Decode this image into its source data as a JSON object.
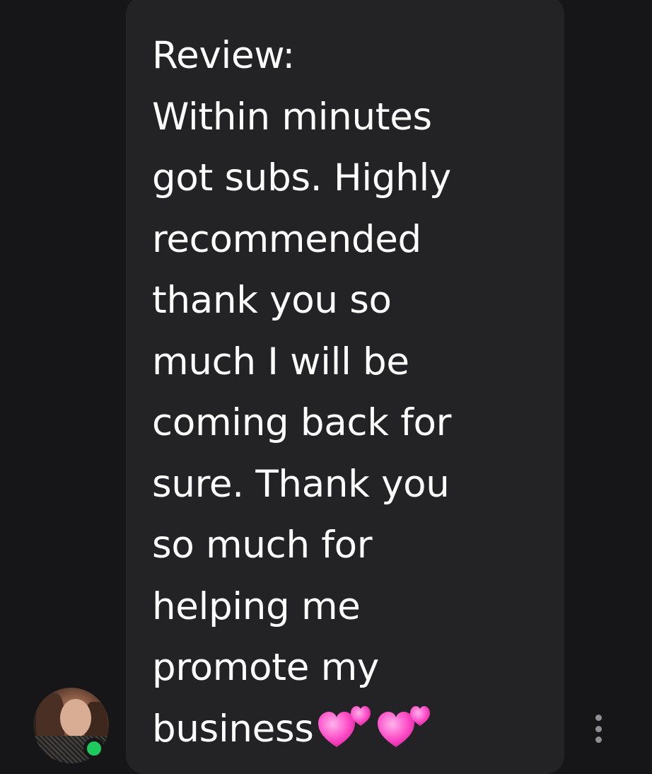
{
  "message": {
    "lines": [
      "Review:",
      "Within minutes",
      "got subs. Highly",
      "recommended",
      "thank you so",
      "much I will be",
      "coming back for",
      "sure. Thank you",
      "so much for",
      "helping me",
      "promote my",
      "business"
    ],
    "emoji": "two-hearts-emoji x2"
  },
  "sender": {
    "avatar": "profile-photo",
    "online_status": "online"
  },
  "actions": {
    "more_icon": "vertical-ellipsis-icon"
  },
  "colors": {
    "background": "#161618",
    "bubble": "#232326",
    "text": "#ffffff",
    "online": "#1ec85c",
    "heart": "#ff4fc8"
  }
}
